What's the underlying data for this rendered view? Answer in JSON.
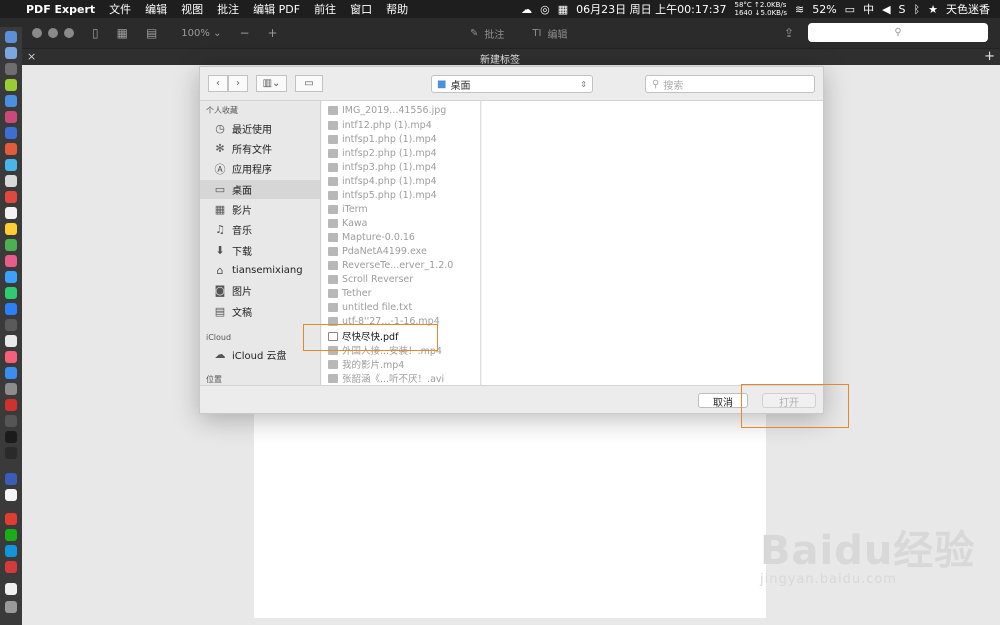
{
  "menubar": {
    "app_name": "PDF Expert",
    "items": [
      "文件",
      "编辑",
      "视图",
      "批注",
      "编辑 PDF",
      "前往",
      "窗口",
      "帮助"
    ],
    "temp": "58°C",
    "fan": "1640",
    "net_up": "↑2.0KB/s",
    "net_down": "↓5.0KB/s",
    "datetime": "06月23日 周日 上午00:17:37",
    "battery": "52%",
    "input": "中",
    "user": "天色迷香"
  },
  "toolbar": {
    "zoom": "100%",
    "annotate_label": "批注",
    "edit_label": "编辑"
  },
  "tabbar": {
    "title": "新建标签",
    "close_glyph": "×",
    "add_glyph": "+"
  },
  "dialog": {
    "location": "桌面",
    "search_placeholder": "搜索",
    "sidebar": {
      "favorites_title": "个人收藏",
      "favorites": [
        {
          "label": "最近使用",
          "icon": "clock-icon"
        },
        {
          "label": "所有文件",
          "icon": "gear-icon"
        },
        {
          "label": "应用程序",
          "icon": "apps-icon"
        },
        {
          "label": "桌面",
          "icon": "desktop-icon"
        },
        {
          "label": "影片",
          "icon": "film-icon"
        },
        {
          "label": "音乐",
          "icon": "music-icon"
        },
        {
          "label": "下载",
          "icon": "download-icon"
        },
        {
          "label": "tiansemixiang",
          "icon": "home-icon"
        },
        {
          "label": "图片",
          "icon": "camera-icon"
        },
        {
          "label": "文稿",
          "icon": "document-icon"
        }
      ],
      "icloud_title": "iCloud",
      "icloud": [
        {
          "label": "iCloud 云盘",
          "icon": "cloud-icon"
        }
      ],
      "locations_title": "位置"
    },
    "files": [
      "IMG_2019...41556.jpg",
      "intf12.php (1).mp4",
      "intfsp1.php (1).mp4",
      "intfsp2.php (1).mp4",
      "intfsp3.php (1).mp4",
      "intfsp4.php (1).mp4",
      "intfsp5.php (1).mp4",
      "iTerm",
      "Kawa",
      "Mapture-0.0.16",
      "PdaNetA4199.exe",
      "ReverseTe...erver_1.2.0",
      "Scroll Reverser",
      "Tether",
      "untitled file.txt",
      "utf-8''27...-1-16.mp4",
      "尽快尽快.pdf",
      "外国人接...安装！.mp4",
      "我的影片.mp4",
      "张韶涵《...听不厌！.avi"
    ],
    "active_file_index": 16,
    "cancel_label": "取消",
    "open_label": "打开"
  },
  "watermark": {
    "main": "Baidu经验",
    "sub": "jingyan.baidu.com"
  },
  "colors": {
    "highlight": "#e8862a",
    "menubar": "#1e1e1e",
    "toolbar": "#2b2b2b"
  }
}
